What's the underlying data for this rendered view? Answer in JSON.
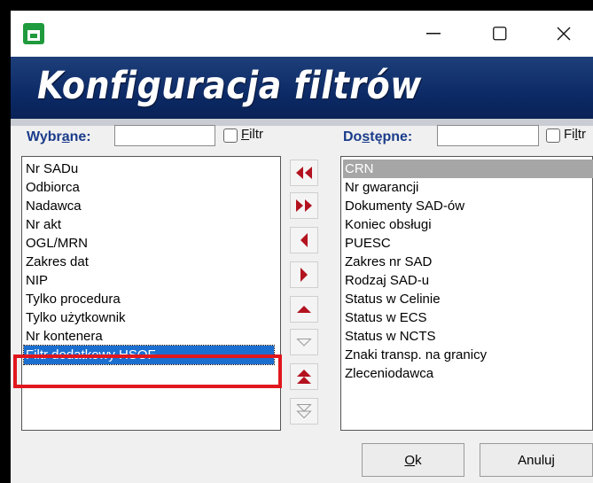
{
  "window": {
    "minimize": "—",
    "maximize": "☐",
    "close": "✕"
  },
  "banner": {
    "title": "Konfiguracja filtrów"
  },
  "left": {
    "label": "Wybrane:",
    "filter_label": "Filtr",
    "items": [
      "Nr SADu",
      "Odbiorca",
      "Nadawca",
      "Nr akt",
      "OGL/MRN",
      "Zakres dat",
      "NIP",
      "Tylko procedura",
      "Tylko użytkownik",
      "Nr kontenera",
      "Filtr dodatkowy HSOF"
    ],
    "selected": "Filtr dodatkowy HSOF"
  },
  "right": {
    "label": "Dostępne:",
    "filter_label": "Filtr",
    "items": [
      "CRN",
      "Nr gwarancji",
      "Dokumenty SAD-ów",
      "Koniec obsługi",
      "PUESC",
      "Zakres nr SAD",
      "Rodzaj SAD-u",
      "Status w Celinie",
      "Status w ECS",
      "Status w NCTS",
      "Znaki transp. na granicy",
      "Zleceniodawca"
    ],
    "selected": "CRN"
  },
  "move_buttons": [
    {
      "icon": "double-left-arrow-icon",
      "enabled": true
    },
    {
      "icon": "double-right-arrow-icon",
      "enabled": true
    },
    {
      "icon": "left-arrow-icon",
      "enabled": true
    },
    {
      "icon": "right-arrow-icon",
      "enabled": true
    },
    {
      "icon": "up-arrow-icon",
      "enabled": true
    },
    {
      "icon": "down-arrow-icon",
      "enabled": false
    },
    {
      "icon": "move-top-icon",
      "enabled": true
    },
    {
      "icon": "move-bottom-icon",
      "enabled": false
    }
  ],
  "buttons": {
    "ok": "Ok",
    "cancel": "Anuluj"
  },
  "colors": {
    "banner": "#0c2a66",
    "label": "#1a3c8a",
    "selection": "#1b6fd0",
    "highlight_frame": "#e1171e",
    "arrows": "#b3121f"
  }
}
